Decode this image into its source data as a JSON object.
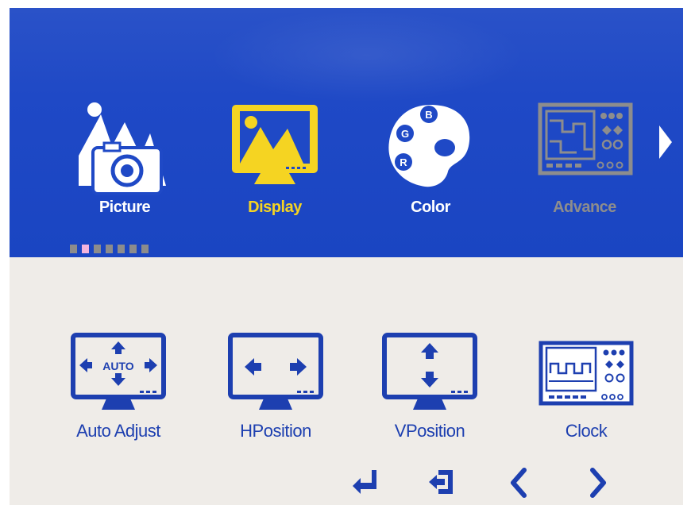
{
  "colors": {
    "menu_background": "#1f49c6",
    "selected_accent": "#f5d422",
    "unselected_text": "#ffffff",
    "disabled_gray": "#8d8d8d",
    "submenu_background": "#efece8",
    "submenu_icon_blue": "#1d3fb0",
    "page_dot_active": "#f4b4dd"
  },
  "main_menu": {
    "selected": "Display",
    "items": [
      {
        "label": "Picture",
        "icon": "picture-icon",
        "state": "normal"
      },
      {
        "label": "Display",
        "icon": "display-icon",
        "state": "selected"
      },
      {
        "label": "Color",
        "icon": "color-palette-icon",
        "state": "normal"
      },
      {
        "label": "Advance",
        "icon": "advance-icon",
        "state": "disabled"
      }
    ],
    "next_arrow_icon": "chevron-right-icon",
    "page_indicator": {
      "total": 7,
      "active_index": 1
    }
  },
  "sub_menu": {
    "items": [
      {
        "label": "Auto Adjust",
        "icon": "auto-adjust-icon",
        "icon_text": "AUTO"
      },
      {
        "label": "HPosition",
        "icon": "h-position-icon"
      },
      {
        "label": "VPosition",
        "icon": "v-position-icon"
      },
      {
        "label": "Clock",
        "icon": "clock-icon"
      }
    ]
  },
  "bottom_nav": [
    {
      "icon": "enter-icon"
    },
    {
      "icon": "exit-icon"
    },
    {
      "icon": "chevron-left-icon"
    },
    {
      "icon": "chevron-right-icon"
    }
  ]
}
